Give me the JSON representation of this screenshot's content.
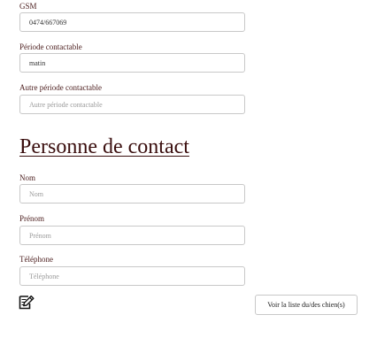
{
  "form": {
    "gsm": {
      "label": "GSM",
      "value": "0474/667069",
      "placeholder": ""
    },
    "contact_period": {
      "label": "Période contactable",
      "value": "matin",
      "placeholder": ""
    },
    "other_contact_period": {
      "label": "Autre période contactable",
      "value": "",
      "placeholder": "Autre période contactable"
    }
  },
  "contact_person": {
    "heading": "Personne de contact",
    "name": {
      "label": "Nom",
      "value": "",
      "placeholder": "Nom"
    },
    "first_name": {
      "label": "Prénom",
      "value": "",
      "placeholder": "Prénom"
    },
    "phone": {
      "label": "Téléphone",
      "value": "",
      "placeholder": "Téléphone"
    }
  },
  "actions": {
    "edit_icon": "pencil-note-icon",
    "dogs_button_label": "Voir la liste du/des chien(s)"
  }
}
